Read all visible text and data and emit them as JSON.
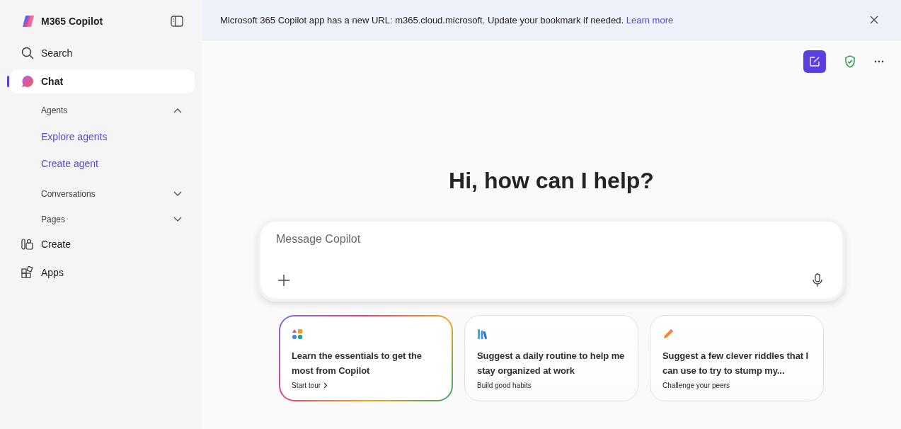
{
  "app": {
    "title": "M365 Copilot"
  },
  "sidebar": {
    "items": [
      {
        "kind": "nav",
        "label": "Search",
        "selected": false
      },
      {
        "kind": "nav",
        "label": "Chat",
        "selected": true
      },
      {
        "kind": "section",
        "label": "Agents",
        "expanded": true,
        "children": [
          {
            "label": "Explore agents"
          },
          {
            "label": "Create agent"
          }
        ]
      },
      {
        "kind": "section",
        "label": "Conversations",
        "expanded": false
      },
      {
        "kind": "section",
        "label": "Pages",
        "expanded": false
      },
      {
        "kind": "nav",
        "label": "Create",
        "selected": false
      },
      {
        "kind": "nav",
        "label": "Apps",
        "selected": false
      }
    ]
  },
  "banner": {
    "message": "Microsoft 365 Copilot app has a new URL: m365.cloud.microsoft. Update your bookmark if needed.",
    "link": "Learn more"
  },
  "heading": "Hi, how can I help?",
  "composer": {
    "placeholder": "Message Copilot"
  },
  "cards": [
    {
      "title": "Learn the essentials to get the most from Copilot",
      "subtitle": "Start tour",
      "featured": true
    },
    {
      "title": "Suggest a daily routine to help me stay organized at work",
      "subtitle": "Build good habits",
      "featured": false
    },
    {
      "title": "Suggest a few clever riddles that I can use to try to stump my...",
      "subtitle": "Challenge your peers",
      "featured": false
    }
  ]
}
